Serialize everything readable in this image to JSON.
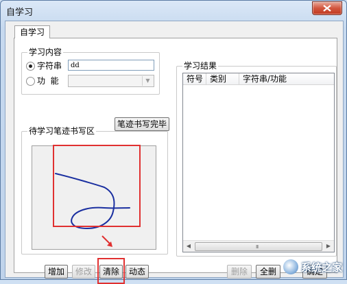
{
  "window": {
    "title": "自学习"
  },
  "tabs": [
    {
      "label": "自学习"
    }
  ],
  "learn_content": {
    "group_title": "学习内容",
    "radio_string": {
      "label": "字符串",
      "checked": true
    },
    "string_value": "dd",
    "radio_function": {
      "label": "功  能",
      "checked": false
    },
    "function_value": ""
  },
  "handwriting": {
    "group_title": "待学习笔迹书写区",
    "done_button": "笔迹书写完毕"
  },
  "buttons": {
    "add": "增加",
    "modify": "修改",
    "clear": "清除",
    "dynamic": "动态",
    "delete": "删除",
    "all": "全删",
    "confirm": "确定"
  },
  "results": {
    "group_title": "学习结果",
    "columns": [
      "符号",
      "类别",
      "字符串/功能"
    ],
    "rows": []
  },
  "scrollbar": {
    "grip": "III"
  },
  "watermark": {
    "text": "系统之家"
  },
  "colors": {
    "highlight_red": "#e03030",
    "stroke_blue": "#1a2fa0",
    "titlebar_blue": "#c6d9ef"
  }
}
